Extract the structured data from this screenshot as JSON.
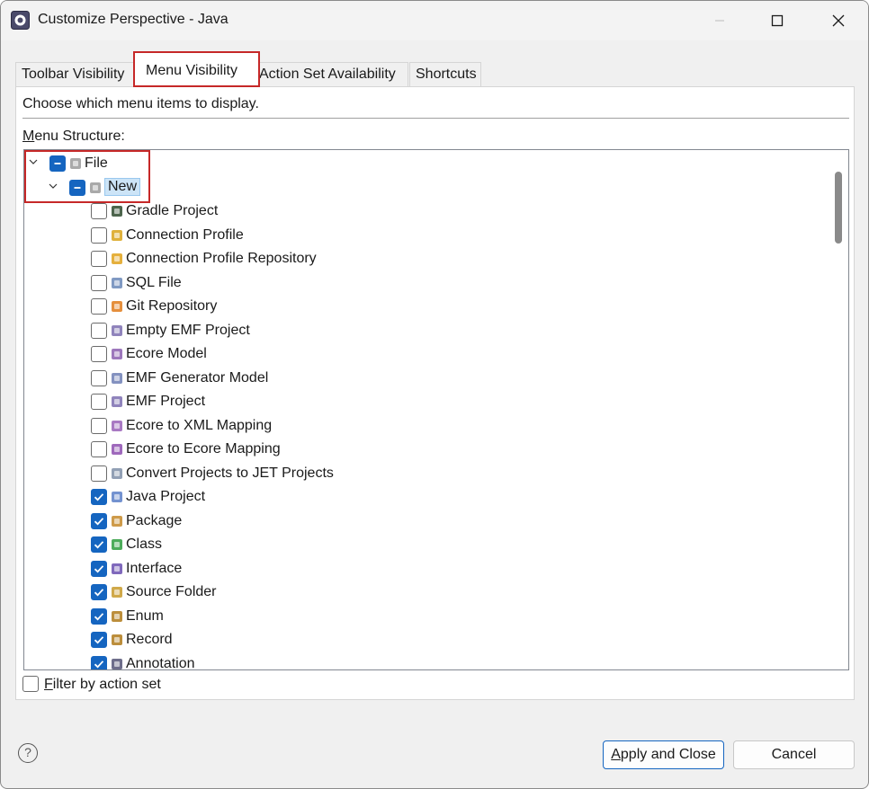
{
  "window": {
    "title": "Customize Perspective - Java",
    "app_icon": "eclipse-icon",
    "controls": [
      "minimize-icon",
      "maximize-icon",
      "close-icon"
    ]
  },
  "tabs": [
    {
      "label": "Toolbar Visibility",
      "selected": false
    },
    {
      "label": "Menu Visibility",
      "selected": true
    },
    {
      "label": "Action Set Availability",
      "selected": false
    },
    {
      "label": "Shortcuts",
      "selected": false
    }
  ],
  "panel": {
    "description": "Choose which menu items to display.",
    "menu_structure_label_accel": "M",
    "menu_structure_label_rest": "enu Structure:"
  },
  "tree": {
    "file": {
      "label": "File",
      "state": "partial",
      "expanded": true,
      "icon": "file-icon"
    },
    "new": {
      "label": "New",
      "state": "partial",
      "expanded": true,
      "selected": true,
      "icon": "new-icon"
    },
    "items": [
      {
        "label": "Gradle Project",
        "checked": false,
        "icon": "gradle-icon"
      },
      {
        "label": "Connection Profile",
        "checked": false,
        "icon": "connection-profile-icon"
      },
      {
        "label": "Connection Profile Repository",
        "checked": false,
        "icon": "repository-icon"
      },
      {
        "label": "SQL File",
        "checked": false,
        "icon": "sql-file-icon"
      },
      {
        "label": "Git Repository",
        "checked": false,
        "icon": "git-repository-icon"
      },
      {
        "label": "Empty EMF Project",
        "checked": false,
        "icon": "emf-project-icon"
      },
      {
        "label": "Ecore Model",
        "checked": false,
        "icon": "ecore-model-icon"
      },
      {
        "label": "EMF Generator Model",
        "checked": false,
        "icon": "emf-generator-icon"
      },
      {
        "label": "EMF Project",
        "checked": false,
        "icon": "emf-project-icon"
      },
      {
        "label": "Ecore to XML Mapping",
        "checked": false,
        "icon": "xml-mapping-icon"
      },
      {
        "label": "Ecore to Ecore Mapping",
        "checked": false,
        "icon": "ecore-mapping-icon"
      },
      {
        "label": "Convert Projects to JET Projects",
        "checked": false,
        "icon": "jet-convert-icon"
      },
      {
        "label": "Java Project",
        "checked": true,
        "icon": "java-project-icon"
      },
      {
        "label": "Package",
        "checked": true,
        "icon": "package-icon"
      },
      {
        "label": "Class",
        "checked": true,
        "icon": "class-icon"
      },
      {
        "label": "Interface",
        "checked": true,
        "icon": "interface-icon"
      },
      {
        "label": "Source Folder",
        "checked": true,
        "icon": "source-folder-icon"
      },
      {
        "label": "Enum",
        "checked": true,
        "icon": "enum-icon"
      },
      {
        "label": "Record",
        "checked": true,
        "icon": "record-icon"
      },
      {
        "label": "Annotation",
        "checked": true,
        "icon": "annotation-icon"
      }
    ]
  },
  "filter": {
    "accel": "F",
    "rest": "ilter by action set",
    "checked": false
  },
  "buttons": {
    "apply_accel": "A",
    "apply_rest": "pply and Close",
    "cancel": "Cancel"
  },
  "help_icon": "help-icon"
}
